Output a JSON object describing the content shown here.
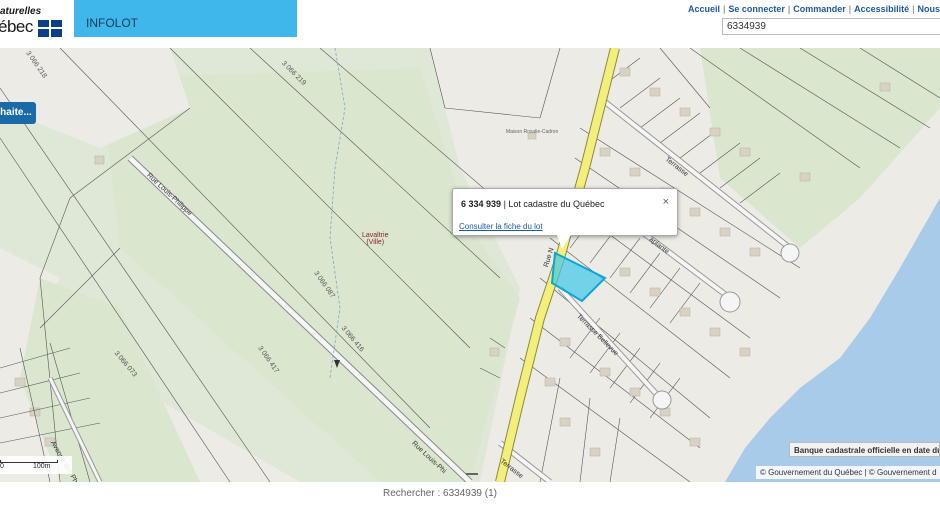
{
  "header": {
    "logo_line1": "aturelles",
    "logo_line2": "ébec",
    "app_title": "INFOLOT",
    "nav": [
      "Accueil",
      "Se connecter",
      "Commander",
      "Accessibilité",
      "Nous"
    ],
    "search_value": "6334939"
  },
  "map": {
    "action_button_label": "haite...",
    "popup": {
      "lot_number": "6 334 939",
      "lot_type": "| Lot cadastre du Québec",
      "link": "Consulter la fiche du lot",
      "close": "×"
    },
    "place": {
      "name": "Lavaltrie",
      "sub": "(Ville)"
    },
    "poi": "Maison Rosalie-Cadron",
    "lot_labels": [
      "3 066 218",
      "3 066 219",
      "3 066 087",
      "3 066 416",
      "3 066 417",
      "3 066 073"
    ],
    "streets": [
      "Rue Louis-Philippe",
      "Rue Louis-Phi",
      "Rue N",
      "Terrasse Bellevue",
      "Terrasse",
      "aplante",
      "Avenue des Ph",
      "Terrasse "
    ],
    "scale": {
      "zero": "0",
      "max": "100m"
    },
    "banque_label": "Banque cadastrale officielle en date du",
    "copyright": "© Gouvernement du Québec | © Gouvernement d",
    "colors": {
      "lot_highlight": "#3fc9e8",
      "road": "#f4ee7a",
      "river": "#a8cbe9",
      "green": "#dbe7d0",
      "header_band": "#3fb7ea"
    }
  },
  "footer": {
    "search_result": "Rechercher : 6334939 (1)"
  }
}
